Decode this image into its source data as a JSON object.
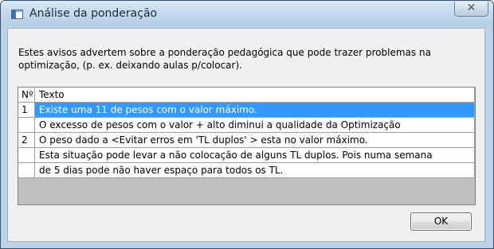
{
  "window": {
    "title": "Análise da ponderação",
    "close_glyph": "✕"
  },
  "description": "Estes avisos advertem sobre a ponderação pedagógica que pode trazer problemas na optimização, (p. ex. deixando aulas p/colocar).",
  "grid": {
    "headers": {
      "num": "Nº",
      "text": "Texto"
    },
    "rows": [
      {
        "num": "1",
        "text": "Existe uma  11 de pesos com o valor máximo.",
        "selected": true
      },
      {
        "num": "",
        "text": "O excesso de pesos com o valor + alto diminui a qualidade da Optimização",
        "selected": false
      },
      {
        "num": "2",
        "text": "O peso dado a  <Evitar erros em 'TL duplos' > esta no valor máximo.",
        "selected": false
      },
      {
        "num": "",
        "text": "Esta situação pode levar a não colocação de alguns TL duplos. Pois numa semana",
        "selected": false
      },
      {
        "num": "",
        "text": "de 5 dias pode não haver espaço para todos os TL.",
        "selected": false
      }
    ]
  },
  "buttons": {
    "ok_label": "OK"
  },
  "colors": {
    "selection": "#3399ff",
    "grid_background": "#c0c0c0"
  }
}
